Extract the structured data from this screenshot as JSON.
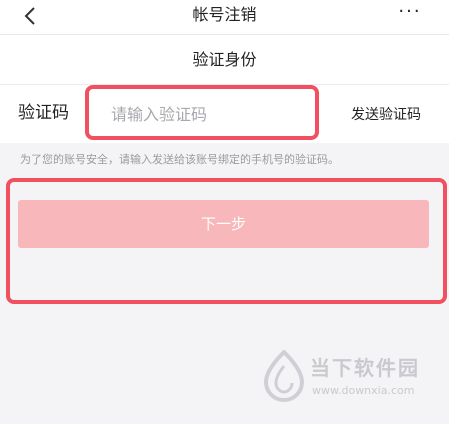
{
  "header": {
    "title": "帐号注销",
    "more_label": "···"
  },
  "subheader": {
    "title": "验证身份"
  },
  "verification": {
    "label": "验证码",
    "placeholder": "请输入验证码",
    "value": "",
    "send_label": "发送验证码"
  },
  "notice": "为了您的账号安全，请输入发送给该账号绑定的手机号的验证码。",
  "next_label": "下一步",
  "watermark": {
    "text": "当下软件园",
    "url": "www.downxia.com"
  },
  "colors": {
    "highlight": "#f0505f",
    "button_bg": "#f8b7ba",
    "page_bg": "#f4f4f6"
  }
}
